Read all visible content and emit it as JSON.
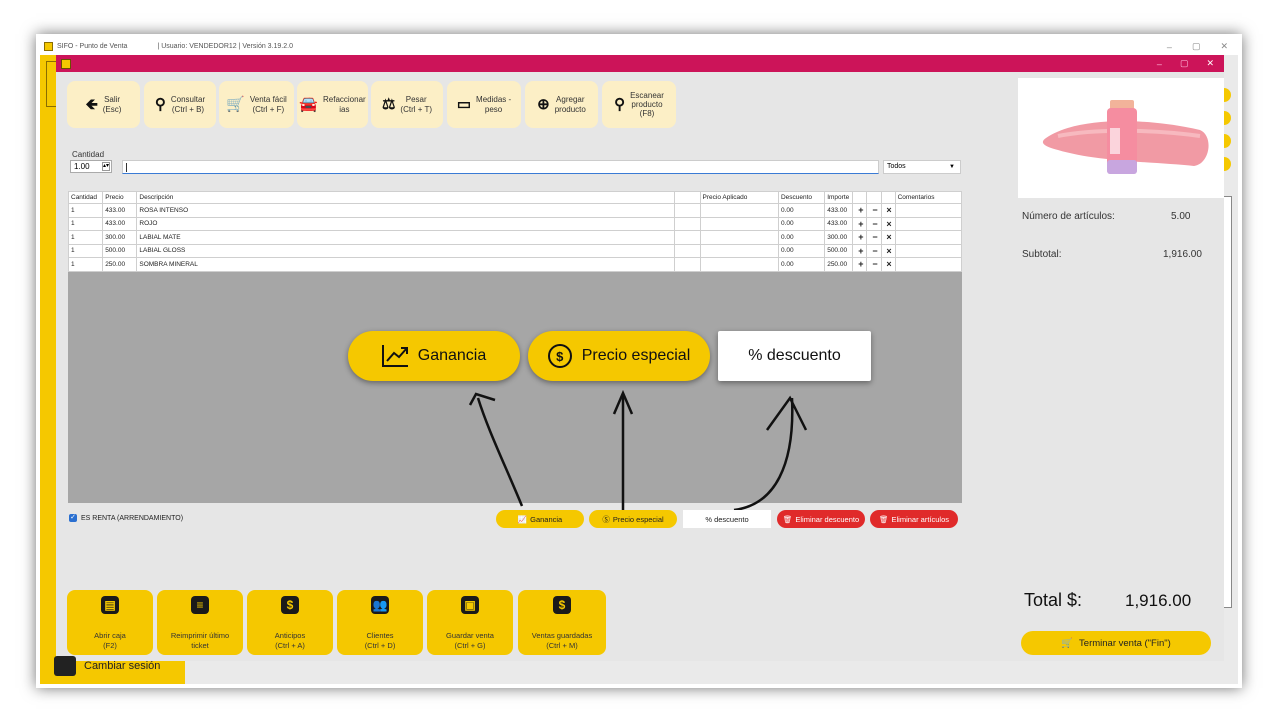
{
  "window": {
    "title": "SIFO - Punto de Venta",
    "user_info": "| Usuario: VENDEDOR12 | Versión 3.19.2.0"
  },
  "toolbar": [
    {
      "icon": "back-arrow-icon",
      "label": "Salir\n(Esc)"
    },
    {
      "icon": "search-icon",
      "label": "Consultar\n(Ctrl + B)"
    },
    {
      "icon": "cart-icon",
      "label": "Venta fácil\n(Ctrl + F)"
    },
    {
      "icon": "car-icon",
      "label": "Refaccionar\nias"
    },
    {
      "icon": "scale-icon",
      "label": "Pesar\n(Ctrl + T)"
    },
    {
      "icon": "tape-measure-icon",
      "label": "Medidas -\npeso"
    },
    {
      "icon": "plus-circle-icon",
      "label": "Agregar\nproducto"
    },
    {
      "icon": "barcode-scan-icon",
      "label": "Escanear\nproducto\n(F8)"
    }
  ],
  "quantity": {
    "label": "Cantidad",
    "value": "1.00"
  },
  "search": {
    "value": ""
  },
  "filter": {
    "selected": "Todos"
  },
  "table": {
    "columns": [
      "Cantidad",
      "Precio",
      "Descripción",
      "Precio Aplicado",
      "Descuento",
      "Importe",
      "",
      "",
      "",
      "Comentarios"
    ],
    "rows": [
      {
        "cantidad": "1",
        "precio": "433.00",
        "descripcion": "ROSA INTENSO",
        "precio_aplicado": "",
        "descuento": "0.00",
        "importe": "433.00",
        "comentarios": ""
      },
      {
        "cantidad": "1",
        "precio": "433.00",
        "descripcion": "ROJO",
        "precio_aplicado": "",
        "descuento": "0.00",
        "importe": "433.00",
        "comentarios": ""
      },
      {
        "cantidad": "1",
        "precio": "300.00",
        "descripcion": "LABIAL MATE",
        "precio_aplicado": "",
        "descuento": "0.00",
        "importe": "300.00",
        "comentarios": ""
      },
      {
        "cantidad": "1",
        "precio": "500.00",
        "descripcion": "LABIAL GLOSS",
        "precio_aplicado": "",
        "descuento": "0.00",
        "importe": "500.00",
        "comentarios": ""
      },
      {
        "cantidad": "1",
        "precio": "250.00",
        "descripcion": "SOMBRA MINERAL",
        "precio_aplicado": "",
        "descuento": "0.00",
        "importe": "250.00",
        "comentarios": ""
      }
    ],
    "row_actions": [
      "+",
      "−",
      "×"
    ]
  },
  "renta_checkbox": {
    "label": "ES RENTA (ARRENDAMIENTO)",
    "checked": true
  },
  "actions": {
    "ganancia": "Ganancia",
    "precio_especial": "Precio especial",
    "descuento": "% descuento",
    "eliminar_descuento": "Eliminar descuento",
    "eliminar_articulos": "Eliminar artículos"
  },
  "callouts": {
    "ganancia": "Ganancia",
    "precio_especial": "Precio especial",
    "descuento": "% descuento"
  },
  "bottom_buttons": [
    {
      "icon": "cash-register-icon",
      "label": "Abrir caja\n(F2)"
    },
    {
      "icon": "receipt-icon",
      "label": "Reimprimir último\nticket"
    },
    {
      "icon": "money-bag-icon",
      "label": "Anticipos\n(Ctrl + A)"
    },
    {
      "icon": "users-icon",
      "label": "Clientes\n(Ctrl + D)"
    },
    {
      "icon": "save-bag-icon",
      "label": "Guardar venta\n(Ctrl + G)"
    },
    {
      "icon": "saved-sales-icon",
      "label": "Ventas guardadas\n(Ctrl + M)"
    }
  ],
  "summary": {
    "num_articulos_label": "Número de artículos:",
    "num_articulos_value": "5.00",
    "subtotal_label": "Subtotal:",
    "subtotal_value": "1,916.00",
    "total_label": "Total $:",
    "total_value": "1,916.00",
    "terminar_label": "Terminar venta (\"Fin\")"
  },
  "session": {
    "cambiar_label": "Cambiar sesión"
  },
  "colors": {
    "accent": "#f5c800",
    "titlebar": "#cc1459",
    "danger": "#e02a2a"
  }
}
